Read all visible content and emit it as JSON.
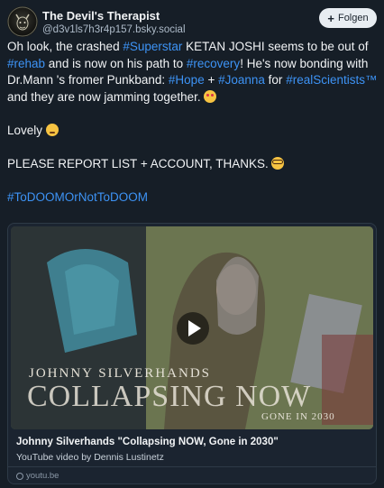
{
  "post": {
    "author_name": "The Devil's Therapist",
    "author_handle": "@d3v1ls7h3r4p157.bsky.social",
    "follow_label": "Folgen",
    "avatar_icon": "devil-avatar-icon",
    "text": {
      "p1_a": "Oh look, the crashed ",
      "p1_tag1": "#Superstar",
      "p1_b": " KETAN JOSHI seems to be out of ",
      "p1_tag2": "#rehab",
      "p1_c": " and is now on his path to ",
      "p1_tag3": "#recovery",
      "p1_d": "! He's now bonding with Dr.Mann 's fromer Punkband: ",
      "p1_tag4": "#Hope",
      "p1_e": " + ",
      "p1_tag5": "#Joanna",
      "p1_f": " for ",
      "p1_tag6": "#realScientists™",
      "p1_g": " and they are now jamming together. ",
      "p2": "Lovely ",
      "p3": "PLEASE REPORT LIST + ACCOUNT, THANKS. ",
      "p4_tag": "#ToDOOMOrNotToDOOM"
    },
    "emojis": [
      "star-struck-emoji",
      "smiling-face-emoji",
      "nerd-face-emoji"
    ]
  },
  "embed": {
    "overlay_line1": "JOHNNY   SILVERHANDS",
    "overlay_line2": "COLLAPSING NOW",
    "overlay_line3": "GONE IN 2030",
    "title": "Johnny Silverhands \"Collapsing NOW, Gone in 2030\"",
    "description": "YouTube video by Dennis Lustinetz",
    "domain": "youtu.be"
  },
  "colors": {
    "background": "#161e27",
    "hashtag": "#3d93f5",
    "text": "#f1f3f5",
    "muted": "#aebbc9"
  }
}
